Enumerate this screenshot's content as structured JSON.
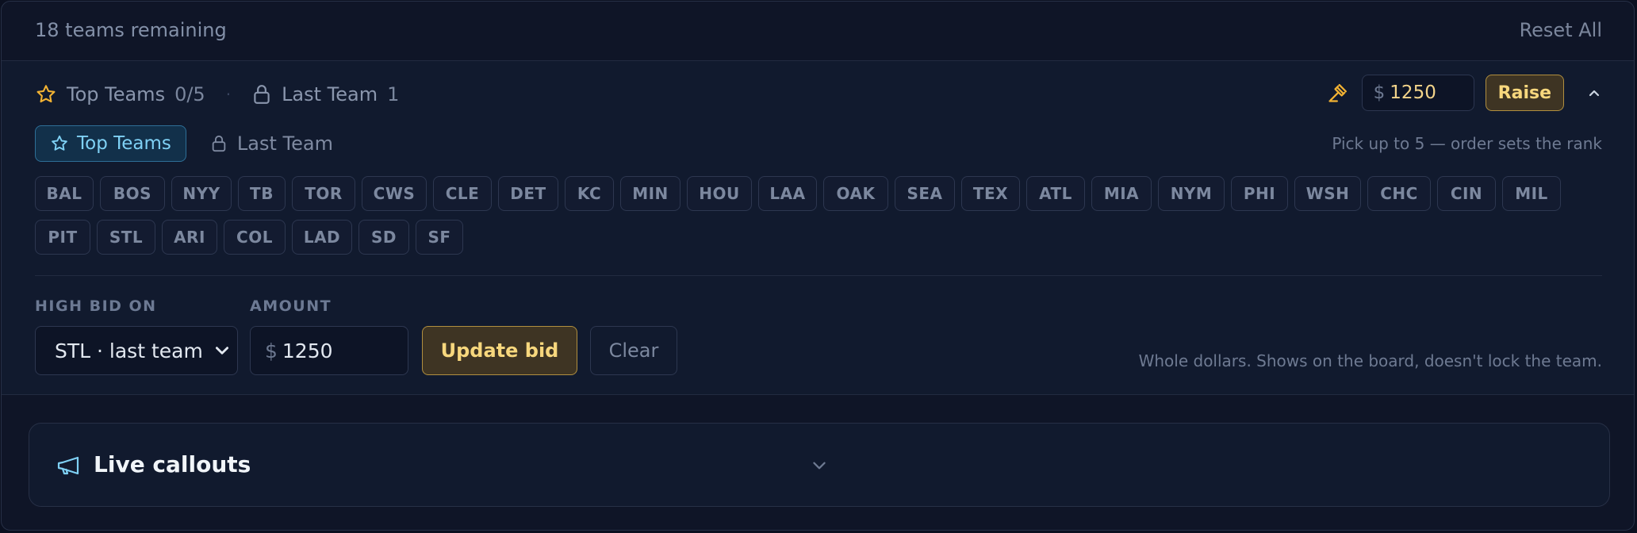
{
  "header": {
    "remaining_text": "18 teams remaining",
    "reset_label": "Reset All"
  },
  "summary": {
    "top_label": "Top Teams",
    "top_count": "0/5",
    "separator": "·",
    "last_label": "Last Team",
    "last_count": "1"
  },
  "raise": {
    "currency": "$",
    "value": "1250",
    "button_label": "Raise"
  },
  "tabs": {
    "active_label": "Top Teams",
    "other_label": "Last Team",
    "hint": "Pick up to 5 — order sets the rank"
  },
  "teams": [
    "BAL",
    "BOS",
    "NYY",
    "TB",
    "TOR",
    "CWS",
    "CLE",
    "DET",
    "KC",
    "MIN",
    "HOU",
    "LAA",
    "OAK",
    "SEA",
    "TEX",
    "ATL",
    "MIA",
    "NYM",
    "PHI",
    "WSH",
    "CHC",
    "CIN",
    "MIL",
    "PIT",
    "STL",
    "ARI",
    "COL",
    "LAD",
    "SD",
    "SF"
  ],
  "bid": {
    "high_bid_label": "HIGH BID ON",
    "selected_team": "STL · last team",
    "amount_label": "AMOUNT",
    "currency": "$",
    "amount_value": "1250",
    "update_label": "Update bid",
    "clear_label": "Clear",
    "hint": "Whole dollars. Shows on the board, doesn't lock the team."
  },
  "callouts": {
    "title": "Live callouts"
  },
  "icons": {
    "star": "star-icon",
    "lock": "lock-icon",
    "gavel": "gavel-icon",
    "chevron_up": "chevron-up-icon",
    "chevron_down": "chevron-down-icon",
    "megaphone": "megaphone-icon"
  },
  "colors": {
    "accent_gold": "#f7d77d",
    "accent_cyan": "#7fd1f5",
    "star_color": "#f2b233"
  }
}
